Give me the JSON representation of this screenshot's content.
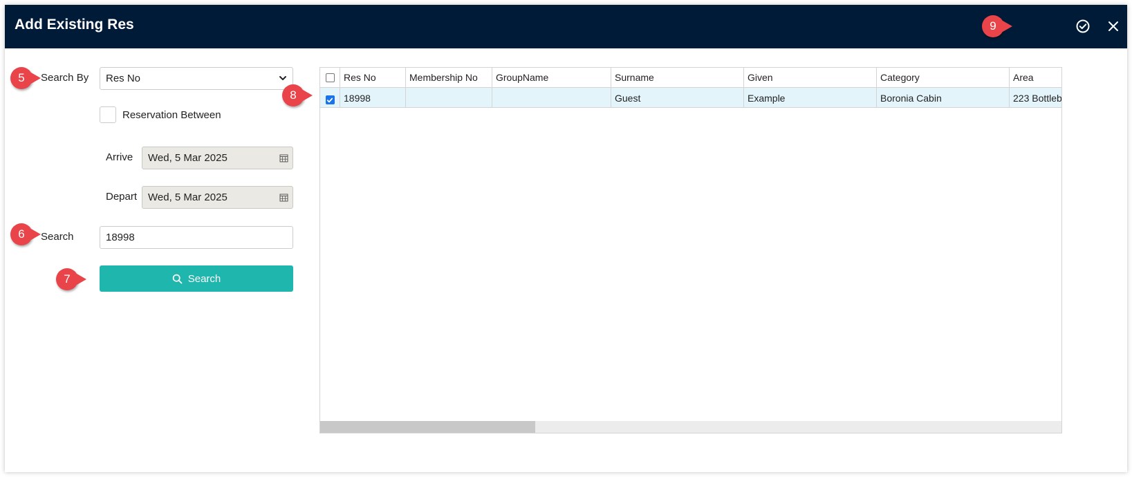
{
  "dialog": {
    "title": "Add Existing Res"
  },
  "callouts": [
    "5",
    "6",
    "7",
    "8",
    "9"
  ],
  "form": {
    "search_by_label": "Search By",
    "search_by_value": "Res No",
    "reservation_between_label": "Reservation Between",
    "arrive_label": "Arrive",
    "arrive_value": "Wed, 5 Mar 2025",
    "depart_label": "Depart",
    "depart_value": "Wed, 5 Mar 2025",
    "search_label": "Search",
    "search_value": "18998",
    "search_button_label": "Search"
  },
  "grid": {
    "columns": [
      "Res No",
      "Membership No",
      "GroupName",
      "Surname",
      "Given",
      "Category",
      "Area"
    ],
    "rows": [
      {
        "checked": true,
        "cells": [
          "18998",
          "",
          "",
          "Guest",
          "Example",
          "Boronia Cabin",
          "223 Bottleb"
        ]
      }
    ],
    "scroll_fraction": 0.29
  },
  "colors": {
    "titlebar": "#001b37",
    "accent": "#1fb6ae",
    "callout": "#e9444a",
    "selected_row": "#e3f4fb"
  }
}
